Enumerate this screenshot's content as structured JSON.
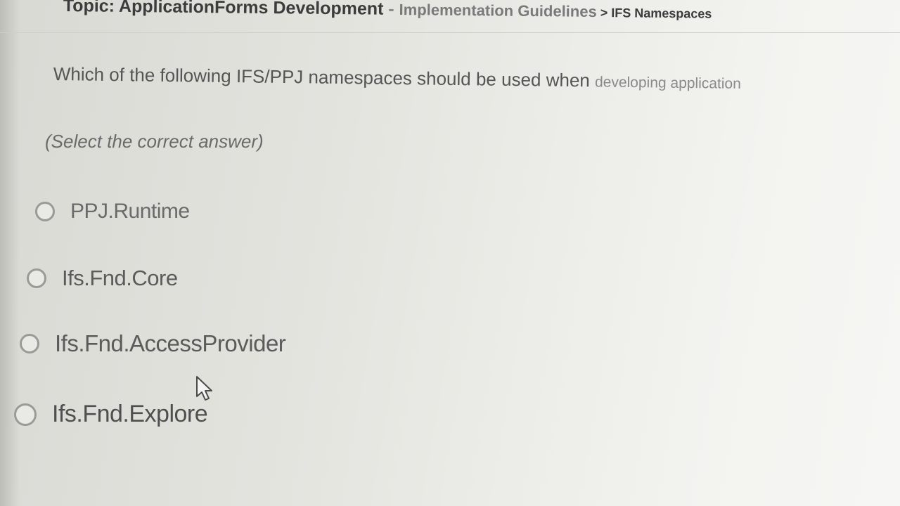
{
  "header": {
    "topic_prefix": "Topic: ApplicationForms Development",
    "separator": " - ",
    "crumb_1": "Implementation Guidelines",
    "crumb_arrow": " > ",
    "crumb_2": "IFS Namespaces"
  },
  "question": {
    "text": "Which of the following IFS/PPJ namespaces should be used when ",
    "text_faded": "developing application",
    "instruction": "(Select the correct answer)"
  },
  "options": [
    {
      "label": "PPJ.Runtime",
      "selected": false
    },
    {
      "label": "Ifs.Fnd.Core",
      "selected": false
    },
    {
      "label": "Ifs.Fnd.AccessProvider",
      "selected": false
    },
    {
      "label": "Ifs.Fnd.Explore",
      "selected": false
    }
  ],
  "colors": {
    "text": "#555555",
    "radio_border": "#9a9a96",
    "background": "#e8e8e4"
  },
  "icons": {
    "cursor": "mouse-pointer-icon"
  }
}
